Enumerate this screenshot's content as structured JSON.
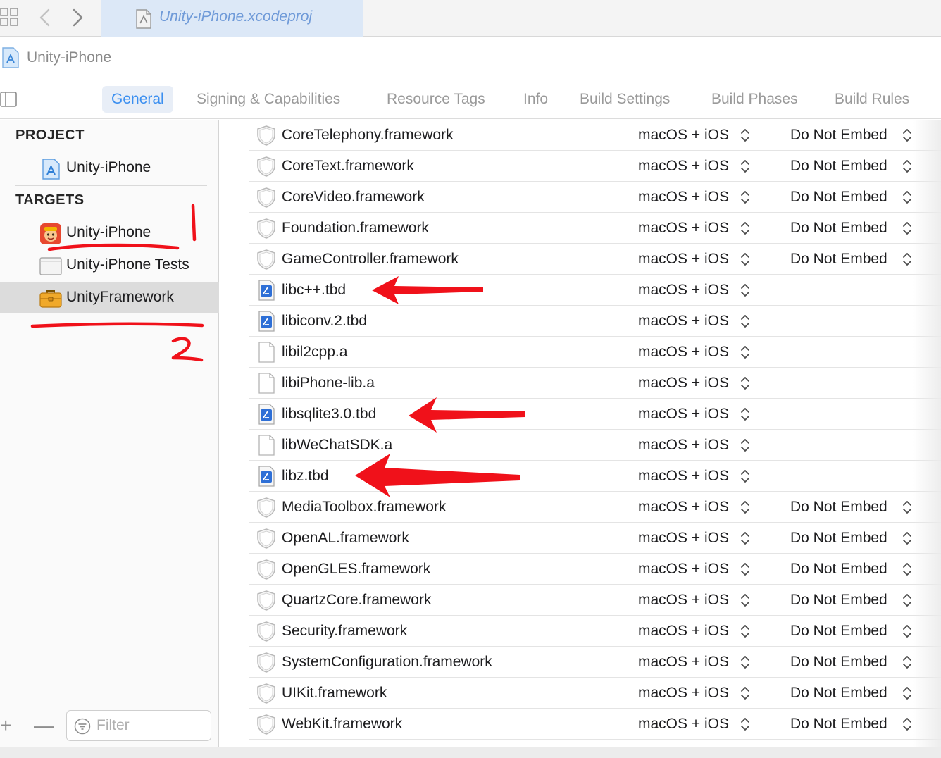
{
  "tabbar": {
    "file_tab_label": "Unity-iPhone.xcodeproj"
  },
  "breadcrumb": {
    "label": "Unity-iPhone"
  },
  "editor_tabs": [
    {
      "label": "General",
      "active": true
    },
    {
      "label": "Signing & Capabilities",
      "active": false
    },
    {
      "label": "Resource Tags",
      "active": false
    },
    {
      "label": "Info",
      "active": false
    },
    {
      "label": "Build Settings",
      "active": false
    },
    {
      "label": "Build Phases",
      "active": false
    },
    {
      "label": "Build Rules",
      "active": false
    }
  ],
  "sidebar": {
    "project_header": "PROJECT",
    "project_item": {
      "label": "Unity-iPhone",
      "icon": "xcode-project-icon"
    },
    "targets_header": "TARGETS",
    "targets": [
      {
        "label": "Unity-iPhone",
        "icon": "unity-app-icon",
        "selected": false
      },
      {
        "label": "Unity-iPhone Tests",
        "icon": "test-bundle-icon",
        "selected": false
      },
      {
        "label": "UnityFramework",
        "icon": "framework-toolbox-icon",
        "selected": true
      }
    ],
    "filter_placeholder": "Filter",
    "add_glyph": "+",
    "remove_glyph": "—"
  },
  "frameworks": [
    {
      "name": "CoreTelephony.framework",
      "type": "framework",
      "platform": "macOS + iOS",
      "embed": "Do Not Embed"
    },
    {
      "name": "CoreText.framework",
      "type": "framework",
      "platform": "macOS + iOS",
      "embed": "Do Not Embed"
    },
    {
      "name": "CoreVideo.framework",
      "type": "framework",
      "platform": "macOS + iOS",
      "embed": "Do Not Embed"
    },
    {
      "name": "Foundation.framework",
      "type": "framework",
      "platform": "macOS + iOS",
      "embed": "Do Not Embed"
    },
    {
      "name": "GameController.framework",
      "type": "framework",
      "platform": "macOS + iOS",
      "embed": "Do Not Embed"
    },
    {
      "name": "libc++.tbd",
      "type": "tbd",
      "platform": "macOS + iOS",
      "embed": ""
    },
    {
      "name": "libiconv.2.tbd",
      "type": "tbd",
      "platform": "macOS + iOS",
      "embed": ""
    },
    {
      "name": "libil2cpp.a",
      "type": "archive",
      "platform": "macOS + iOS",
      "embed": ""
    },
    {
      "name": "libiPhone-lib.a",
      "type": "archive",
      "platform": "macOS + iOS",
      "embed": ""
    },
    {
      "name": "libsqlite3.0.tbd",
      "type": "tbd",
      "platform": "macOS + iOS",
      "embed": ""
    },
    {
      "name": "libWeChatSDK.a",
      "type": "archive",
      "platform": "macOS + iOS",
      "embed": ""
    },
    {
      "name": "libz.tbd",
      "type": "tbd",
      "platform": "macOS + iOS",
      "embed": ""
    },
    {
      "name": "MediaToolbox.framework",
      "type": "framework",
      "platform": "macOS + iOS",
      "embed": "Do Not Embed"
    },
    {
      "name": "OpenAL.framework",
      "type": "framework",
      "platform": "macOS + iOS",
      "embed": "Do Not Embed"
    },
    {
      "name": "OpenGLES.framework",
      "type": "framework",
      "platform": "macOS + iOS",
      "embed": "Do Not Embed"
    },
    {
      "name": "QuartzCore.framework",
      "type": "framework",
      "platform": "macOS + iOS",
      "embed": "Do Not Embed"
    },
    {
      "name": "Security.framework",
      "type": "framework",
      "platform": "macOS + iOS",
      "embed": "Do Not Embed"
    },
    {
      "name": "SystemConfiguration.framework",
      "type": "framework",
      "platform": "macOS + iOS",
      "embed": "Do Not Embed"
    },
    {
      "name": "UIKit.framework",
      "type": "framework",
      "platform": "macOS + iOS",
      "embed": "Do Not Embed"
    },
    {
      "name": "WebKit.framework",
      "type": "framework",
      "platform": "macOS + iOS",
      "embed": "Do Not Embed"
    }
  ],
  "annotations": {
    "color": "#f0111a",
    "marker_1_label": "1",
    "marker_2_label": "2",
    "arrow_targets": [
      "libc++.tbd",
      "libsqlite3.0.tbd",
      "libz.tbd"
    ]
  },
  "colors": {
    "accent": "#3b8ff0",
    "selected_row": "#dcdcdc",
    "file_tab": "#dce8f7"
  }
}
